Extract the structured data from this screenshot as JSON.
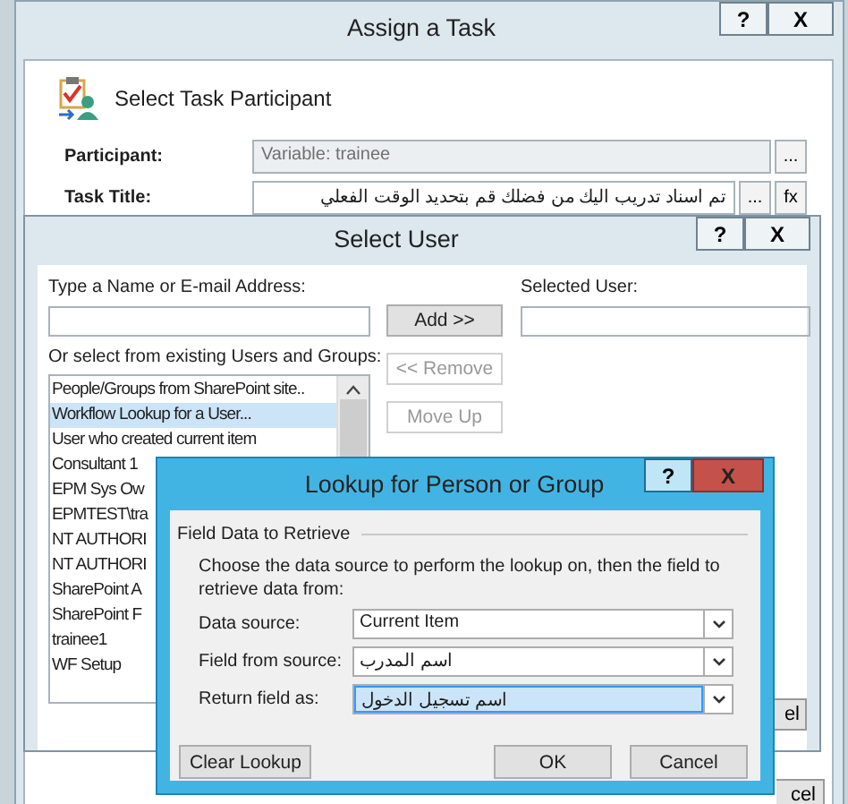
{
  "assign_task": {
    "title": "Assign a Task",
    "help_button": "?",
    "close_button": "X",
    "heading": "Select Task Participant",
    "fields": [
      {
        "label": "Participant:",
        "value": "Variable: trainee",
        "disabled": true,
        "buttons": [
          "..."
        ]
      },
      {
        "label": "Task Title:",
        "value": "تم اسناد تدريب اليك من فضلك قم بتحديد الوقت الفعلي",
        "disabled": false,
        "buttons": [
          "...",
          "fx"
        ]
      }
    ],
    "footer_button": "cel"
  },
  "select_user": {
    "title": "Select User",
    "help_button": "?",
    "close_button": "X",
    "name_label": "Type a Name or E-mail Address:",
    "add_button": "Add >>",
    "selected_label": "Selected User:",
    "list_label": "Or select from existing Users and Groups:",
    "items": [
      {
        "label": "People/Groups from SharePoint site..",
        "selected": false
      },
      {
        "label": "Workflow Lookup for a User...",
        "selected": true
      },
      {
        "label": "User who created current item",
        "selected": false
      },
      {
        "label": "Consultant 1",
        "selected": false
      },
      {
        "label": "EPM Sys Ow",
        "selected": false
      },
      {
        "label": "EPMTEST\\tra",
        "selected": false
      },
      {
        "label": "NT AUTHORI",
        "selected": false
      },
      {
        "label": "NT AUTHORI",
        "selected": false
      },
      {
        "label": "SharePoint A",
        "selected": false
      },
      {
        "label": "SharePoint F",
        "selected": false
      },
      {
        "label": "trainee1",
        "selected": false
      },
      {
        "label": "WF Setup",
        "selected": false
      }
    ],
    "side_buttons": [
      {
        "label": "<< Remove",
        "disabled": true
      },
      {
        "label": "Move Up",
        "disabled": true
      }
    ],
    "footer_button": "el"
  },
  "lookup": {
    "title": "Lookup for Person or Group",
    "help_button": "?",
    "close_button": "X",
    "group_label": "Field Data to Retrieve",
    "description": "Choose the data source to perform the lookup on, then the field to retrieve data from:",
    "rows": [
      {
        "label": "Data source:",
        "value": "Current Item",
        "selected": false
      },
      {
        "label": "Field from source:",
        "value": "اسم المدرب",
        "selected": false
      },
      {
        "label": "Return field as:",
        "value": "اسم تسجيل الدخول",
        "selected": true
      }
    ],
    "clear_button": "Clear Lookup",
    "ok_button": "OK",
    "cancel_button": "Cancel"
  }
}
